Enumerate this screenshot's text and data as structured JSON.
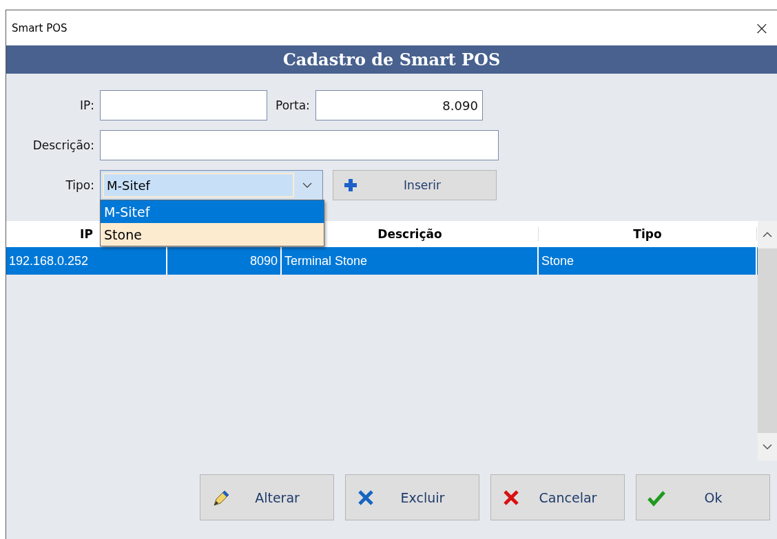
{
  "window": {
    "title": "Smart POS",
    "close": "×"
  },
  "header": {
    "title": "Cadastro de Smart POS"
  },
  "form": {
    "ip": {
      "label": "IP:"
    },
    "porta": {
      "label": "Porta:",
      "value": "8.090"
    },
    "descricao": {
      "label": "Descrição:"
    },
    "tipo": {
      "label": "Tipo:",
      "value": "M-Sitef",
      "expanded": true,
      "options": [
        {
          "label": "M-Sitef",
          "selected": true
        },
        {
          "label": "Stone",
          "selected": false
        }
      ]
    },
    "insert_button": {
      "label": "Inserir"
    }
  },
  "table": {
    "columns": [
      {
        "label": "IP"
      },
      {},
      {
        "label": "Descrição"
      },
      {
        "label": "Tipo"
      }
    ],
    "rows": [
      {
        "cells": [
          "192.168.0.252",
          "8090",
          "Terminal Stone",
          "Stone"
        ],
        "selected": true
      }
    ]
  },
  "buttons": [
    {
      "label": "Alterar",
      "kind": "edit"
    },
    {
      "label": "Excluir",
      "kind": "delete"
    },
    {
      "label": "Cancelar",
      "kind": "cancel"
    },
    {
      "label": "Ok",
      "kind": "ok"
    }
  ]
}
